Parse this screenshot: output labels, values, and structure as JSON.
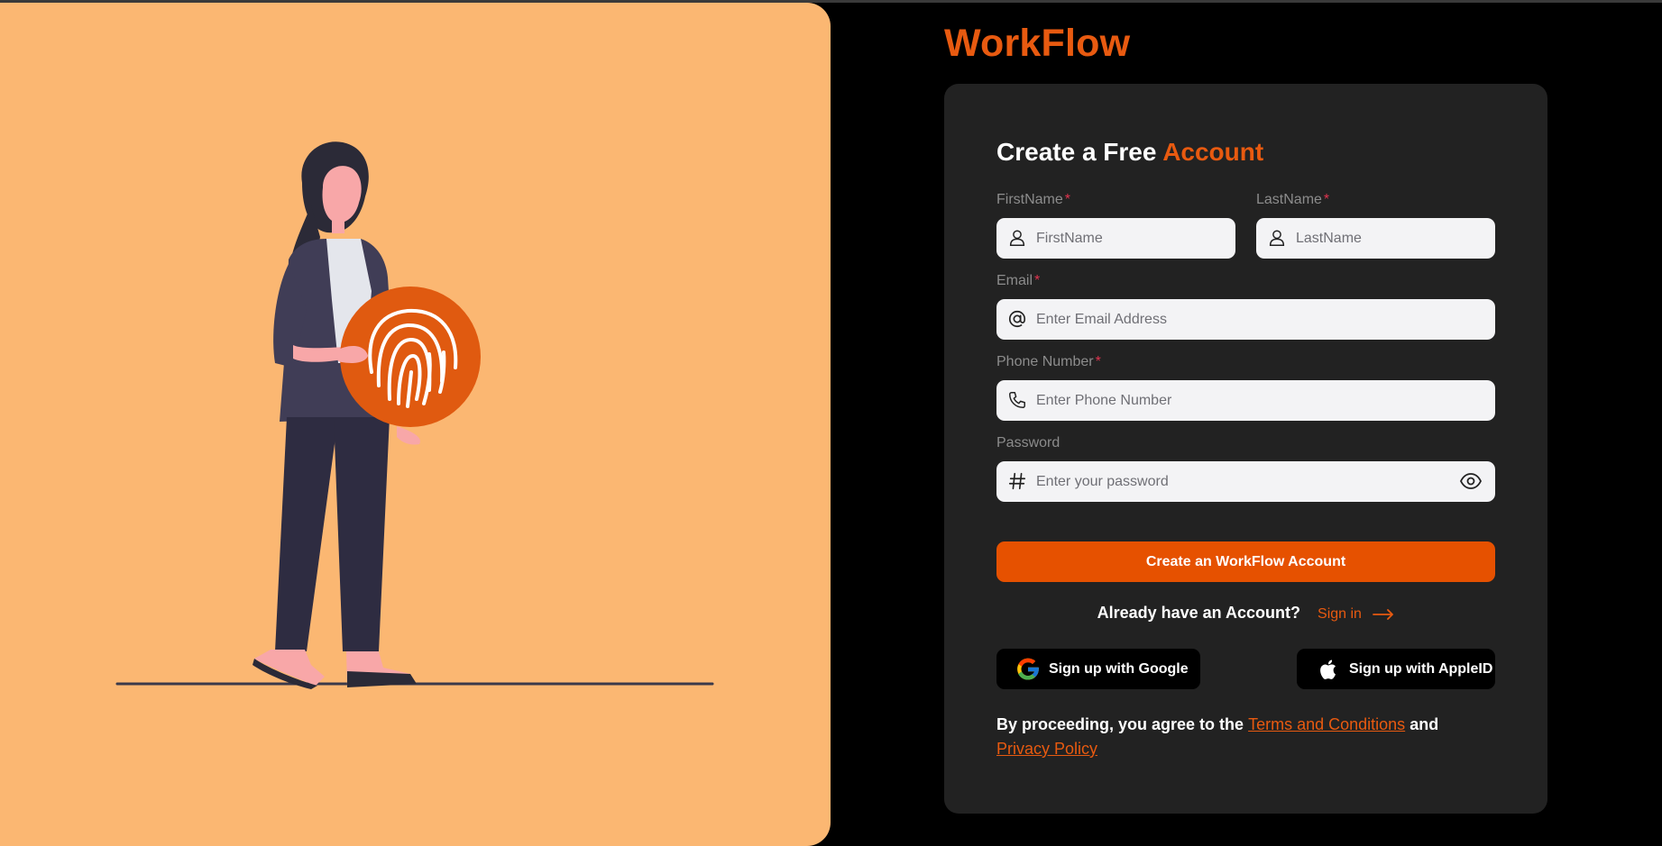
{
  "app": {
    "logo": "WorkFlow"
  },
  "form": {
    "title_main": "Create a Free",
    "title_accent": "Account",
    "required_mark": "*",
    "first_name": {
      "label": "FirstName",
      "placeholder": "FirstName",
      "required": true,
      "icon": "user-icon"
    },
    "last_name": {
      "label": "LastName",
      "placeholder": "LastName",
      "required": true,
      "icon": "user-icon"
    },
    "email": {
      "label": "Email",
      "placeholder": "Enter Email Address",
      "required": true,
      "icon": "at-sign-icon"
    },
    "phone": {
      "label": "Phone Number",
      "placeholder": "Enter Phone Number",
      "required": true,
      "icon": "phone-icon"
    },
    "password": {
      "label": "Password",
      "placeholder": "Enter your password",
      "required": false,
      "icon": "hash-icon",
      "toggle_icon": "eye-icon"
    },
    "submit_label": "Create an WorkFlow Account",
    "have_account_text": "Already have an Account?",
    "signin_label": "Sign in",
    "google_label": "Sign up with Google",
    "apple_label": "Sign up with AppleID",
    "terms_prefix": "By proceeding, you agree to the",
    "terms_link": "Terms and Conditions",
    "terms_and": "and",
    "privacy_link": "Privacy Policy"
  },
  "colors": {
    "accent": "#e85a10",
    "illustration_bg": "#fbb772",
    "card_bg": "#222222",
    "page_bg": "#000000",
    "required": "#e0344f"
  },
  "illustration": {
    "subject": "woman-holding-fingerprint-icon"
  }
}
